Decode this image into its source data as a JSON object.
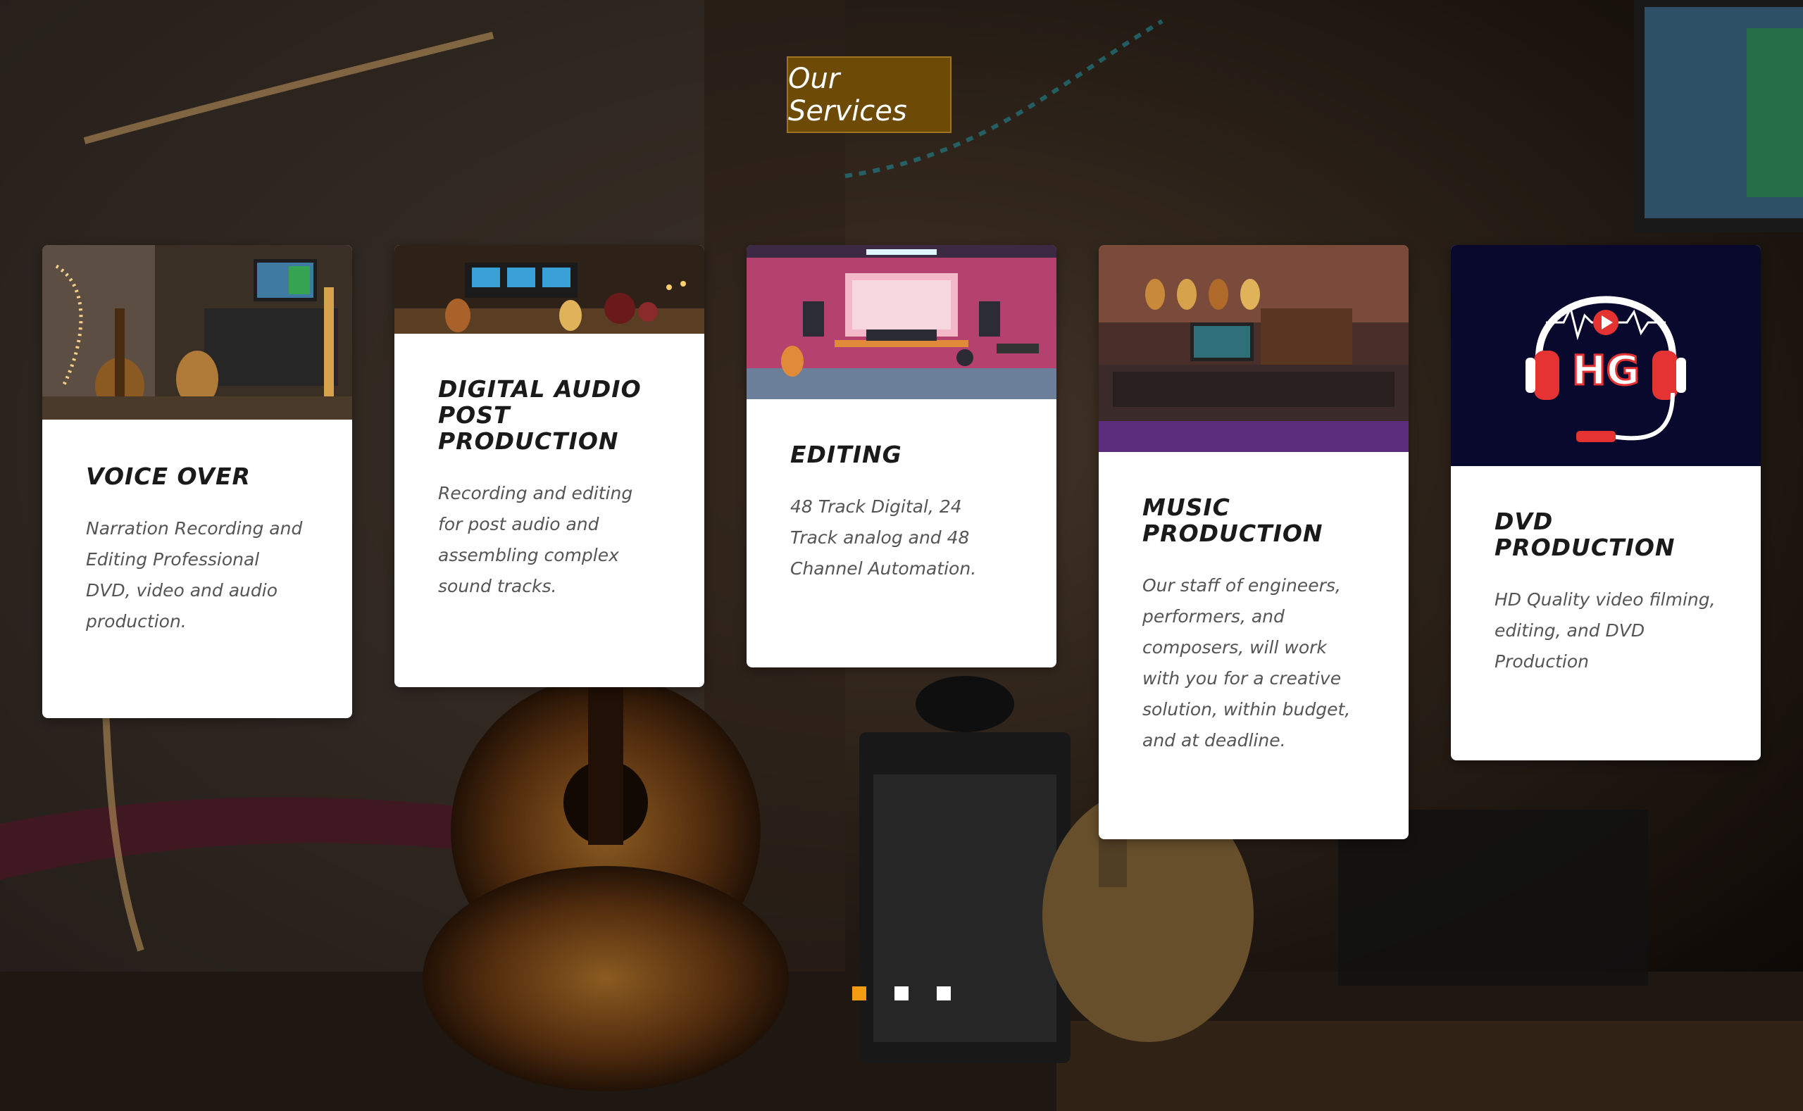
{
  "section": {
    "title": "Our Services"
  },
  "colors": {
    "title_bg": "#6e4a07",
    "active_dot": "#f39c12",
    "card_bg": "#ffffff"
  },
  "cards": [
    {
      "title": "VOICE OVER",
      "description": "Narration Recording and Editing Professional DVD, video and audio production."
    },
    {
      "title": "DIGITAL AUDIO POST PRODUCTION",
      "description": "Recording and editing for post audio and assembling complex sound tracks."
    },
    {
      "title": "EDITING",
      "description": "48 Track Digital, 24 Track analog and 48 Channel Automation."
    },
    {
      "title": "MUSIC PRODUCTION",
      "description": "Our staff of engineers, performers, and composers, will work with you for a creative solution, within budget, and at deadline."
    },
    {
      "title": "DVD PRODUCTION",
      "description": "HD Quality video filming, editing, and DVD Production",
      "logo_text": "HG"
    }
  ],
  "pagination": {
    "pages": 3,
    "active": 1
  }
}
